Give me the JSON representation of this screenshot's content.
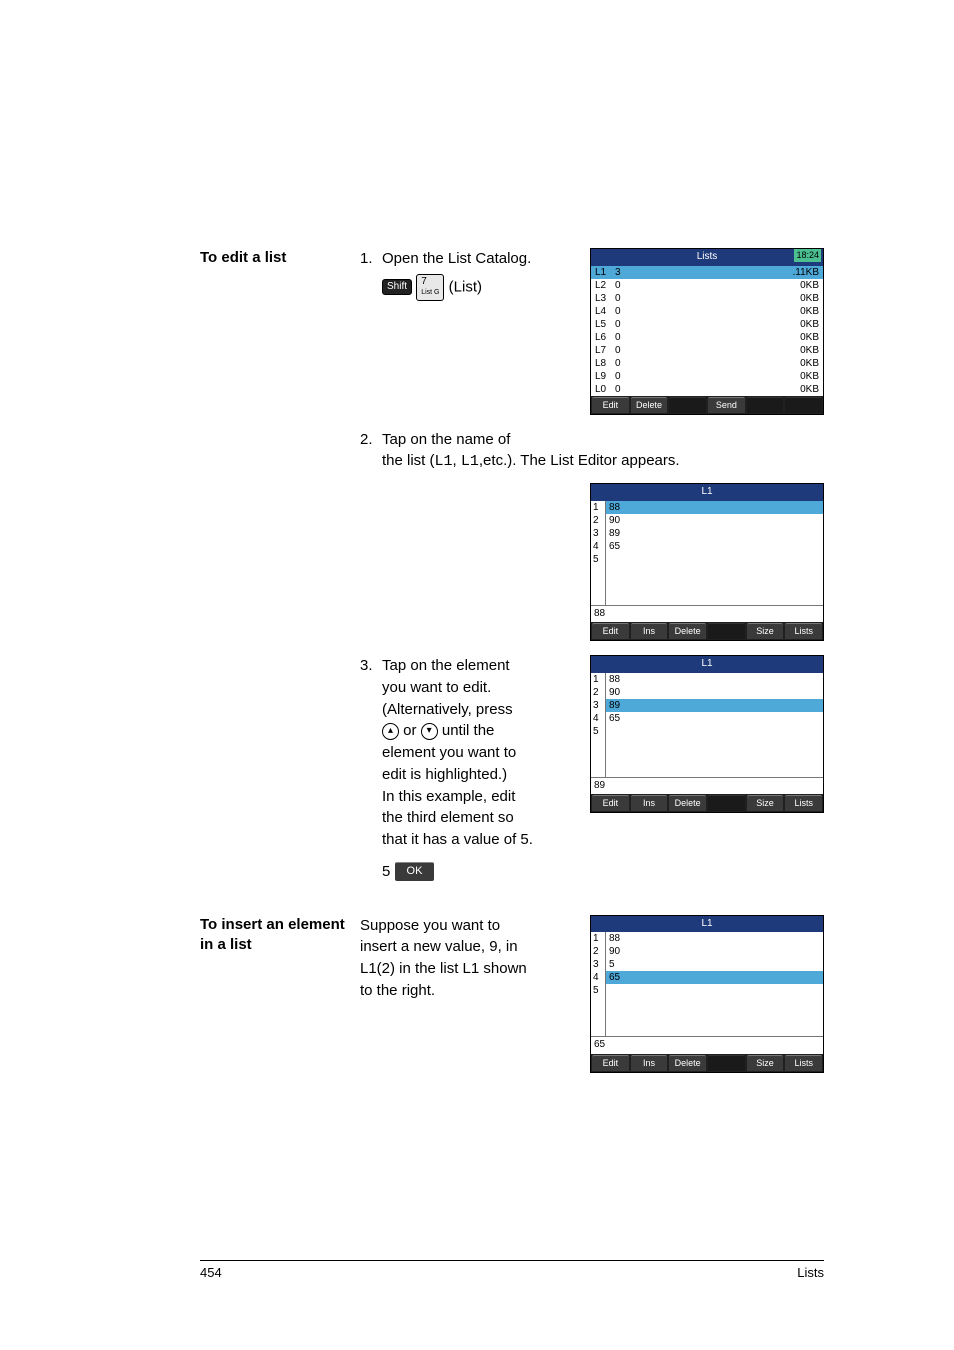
{
  "sections": {
    "edit": {
      "heading": "To edit a list",
      "step1": {
        "num": "1.",
        "text": "Open the List Catalog.",
        "keyShift": "Shift",
        "key7": "7",
        "key7sub": "List  G",
        "keySuffix": "(List)"
      },
      "step2": {
        "num": "2.",
        "lead": "Tap on the name of",
        "rest": "the list (",
        "code1": "L1",
        "code2": "L1",
        "rest2": ",etc.). The List Editor appears."
      },
      "step3": {
        "num": "3.",
        "l1": "Tap on the element",
        "l2": "you want to edit.",
        "l3": "(Alternatively, press",
        "l4a": " or ",
        "l4b": " until the",
        "l5": "element you want to",
        "l6": "edit is highlighted.)",
        "l7": "In this example, edit",
        "l8": "the third element so",
        "l9": "that it has a value of 5.",
        "five": "5",
        "ok": "OK"
      }
    },
    "insert": {
      "heading": "To insert an element in a list",
      "l1": "Suppose you want to",
      "l2": "insert a new value, 9, in",
      "l3": "L1(2) in the list L1 shown",
      "l4": "to the right."
    }
  },
  "shots": {
    "catalog": {
      "title": "Lists",
      "clock": "18:24",
      "rows": [
        {
          "n": "L1",
          "c": "3",
          "s": ".11KB",
          "sel": true
        },
        {
          "n": "L2",
          "c": "0",
          "s": "0KB"
        },
        {
          "n": "L3",
          "c": "0",
          "s": "0KB"
        },
        {
          "n": "L4",
          "c": "0",
          "s": "0KB"
        },
        {
          "n": "L5",
          "c": "0",
          "s": "0KB"
        },
        {
          "n": "L6",
          "c": "0",
          "s": "0KB"
        },
        {
          "n": "L7",
          "c": "0",
          "s": "0KB"
        },
        {
          "n": "L8",
          "c": "0",
          "s": "0KB"
        },
        {
          "n": "L9",
          "c": "0",
          "s": "0KB"
        },
        {
          "n": "L0",
          "c": "0",
          "s": "0KB"
        }
      ],
      "soft": [
        "Edit",
        "Delete",
        "",
        "Send",
        "",
        ""
      ]
    },
    "editor1": {
      "title": "L1",
      "idx": [
        "1",
        "2",
        "3",
        "4",
        "5"
      ],
      "vals": [
        {
          "v": "88",
          "sel": true
        },
        {
          "v": "90"
        },
        {
          "v": "89"
        },
        {
          "v": "65"
        }
      ],
      "entry": "88",
      "soft": [
        "Edit",
        "Ins",
        "Delete",
        "",
        "Size",
        "Lists"
      ]
    },
    "editor2": {
      "title": "L1",
      "idx": [
        "1",
        "2",
        "3",
        "4",
        "5"
      ],
      "vals": [
        {
          "v": "88"
        },
        {
          "v": "90"
        },
        {
          "v": "89",
          "sel": true
        },
        {
          "v": "65"
        }
      ],
      "entry": "89",
      "soft": [
        "Edit",
        "Ins",
        "Delete",
        "",
        "Size",
        "Lists"
      ]
    },
    "editor3": {
      "title": "L1",
      "idx": [
        "1",
        "2",
        "3",
        "4",
        "5"
      ],
      "vals": [
        {
          "v": "88"
        },
        {
          "v": "90"
        },
        {
          "v": "5"
        },
        {
          "v": "65",
          "sel": true
        }
      ],
      "entry": "65",
      "soft": [
        "Edit",
        "Ins",
        "Delete",
        "",
        "Size",
        "Lists"
      ]
    }
  },
  "footer": {
    "page": "454",
    "title": "Lists"
  }
}
